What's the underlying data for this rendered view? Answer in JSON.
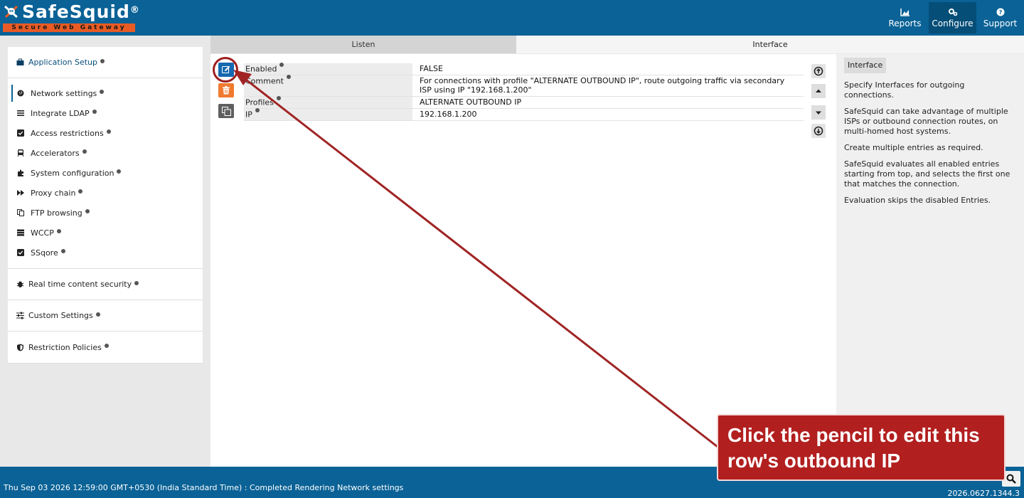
{
  "brand": {
    "name": "SafeSquid",
    "registered": "®",
    "tagline": "Secure Web Gateway"
  },
  "topnav": [
    {
      "label": "Reports",
      "icon": "chart-icon",
      "active": false
    },
    {
      "label": "Configure",
      "icon": "cogs-icon",
      "active": true
    },
    {
      "label": "Support",
      "icon": "question-icon",
      "active": false
    }
  ],
  "sidebar": {
    "application_setup": "Application Setup",
    "items": [
      {
        "label": "Network settings",
        "icon": "globe-icon",
        "active": true
      },
      {
        "label": "Integrate LDAP",
        "icon": "list-icon"
      },
      {
        "label": "Access restrictions",
        "icon": "checkbox-icon"
      },
      {
        "label": "Accelerators",
        "icon": "train-icon"
      },
      {
        "label": "System configuration",
        "icon": "puzzle-icon"
      },
      {
        "label": "Proxy chain",
        "icon": "fast-forward-icon"
      },
      {
        "label": "FTP browsing",
        "icon": "files-icon"
      },
      {
        "label": "WCCP",
        "icon": "server-icon"
      },
      {
        "label": "SSqore",
        "icon": "checkbox-icon"
      }
    ],
    "realtime": "Real time content security",
    "custom": "Custom Settings",
    "restriction": "Restriction Policies"
  },
  "tabs": {
    "listen": "Listen",
    "interface": "Interface"
  },
  "entry": {
    "fields": [
      {
        "label": "Enabled",
        "value": "FALSE"
      },
      {
        "label": "Comment",
        "value": "For connections with profile \"ALTERNATE OUTBOUND IP\", route outgoing traffic via secondary ISP using IP \"192.168.1.200\""
      },
      {
        "label": "Profiles",
        "value": "ALTERNATE OUTBOUND IP"
      },
      {
        "label": "IP",
        "value": "192.168.1.200"
      }
    ]
  },
  "help": {
    "title": "Interface",
    "paragraphs": [
      "Specify Interfaces for outgoing connections.",
      "SafeSquid can take advantage of multiple ISPs or outbound connection routes, on multi-homed host systems.",
      "Create multiple entries as required.",
      "SafeSquid evaluates all enabled entries starting from top, and selects the first one that matches the connection.",
      "Evaluation skips the disabled Entries."
    ]
  },
  "footer": {
    "status": "Thu Sep 03 2026 12:59:00 GMT+0530 (India Standard Time) : Completed Rendering Network settings",
    "version": "2026.0627.1344.3"
  },
  "annotation": {
    "line1": "Click the pencil to edit this",
    "line2": "row's outbound IP"
  }
}
